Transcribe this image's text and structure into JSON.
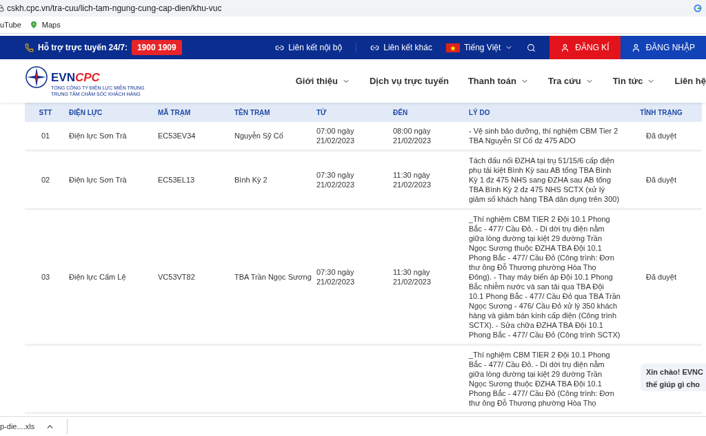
{
  "browser": {
    "url": "cskh.cpc.vn/tra-cuu/lich-tam-ngung-cung-cap-dien/khu-vuc",
    "bookmarks": [
      {
        "label": "uTube",
        "kind": "video"
      },
      {
        "label": "Maps",
        "kind": "maps"
      }
    ]
  },
  "topbar": {
    "support_label": "Hỗ trợ trực tuyến 24/7:",
    "hotline": "1900 1909",
    "links": [
      "Liên kết nội bộ",
      "Liên kết khác"
    ],
    "language": "Tiếng Việt",
    "register": "ĐĂNG KÍ",
    "login": "ĐĂNG NHẬP"
  },
  "header": {
    "logo": {
      "brand_a": "EVN",
      "brand_b": "CPC",
      "line1": "TỔNG CÔNG TY ĐIỆN LỰC MIỀN TRUNG",
      "line2": "TRUNG TÂM CHĂM SÓC KHÁCH HÀNG"
    },
    "nav": [
      {
        "label": "Giới thiệu",
        "dropdown": true
      },
      {
        "label": "Dịch vụ trực tuyến",
        "dropdown": false
      },
      {
        "label": "Thanh toán",
        "dropdown": true
      },
      {
        "label": "Tra cứu",
        "dropdown": true
      },
      {
        "label": "Tin tức",
        "dropdown": true
      },
      {
        "label": "Liên hệ",
        "dropdown": false
      }
    ]
  },
  "table": {
    "columns": [
      "STT",
      "ĐIỆN LỰC",
      "MÃ TRẠM",
      "TÊN TRẠM",
      "TỪ",
      "ĐẾN",
      "LÝ DO",
      "TÌNH TRẠNG"
    ],
    "rows": [
      {
        "stt": "01",
        "dien_luc": "Điện lực Sơn Trà",
        "ma_tram": "EC53EV34",
        "ten_tram": "Nguyễn Sỹ Cố",
        "tu": "07:00 ngày 21/02/2023",
        "den": "08:00 ngày 21/02/2023",
        "ly_do": "- Vệ sinh bảo dưỡng, thí nghiệm CBM Tier 2 TBA Nguyễn Sĩ Cố đz 475 ADO",
        "tinh_trang": "Đã duyệt"
      },
      {
        "stt": "02",
        "dien_luc": "Điện lực Sơn Trà",
        "ma_tram": "EC53EL13",
        "ten_tram": "Bình Kỳ 2",
        "tu": "07:30 ngày 21/02/2023",
        "den": "11:30 ngày 21/02/2023",
        "ly_do": "Tách đấu nối ĐZHA tại trụ 51/15/6 cấp điện phụ tải kiệt Bình Kỳ sau AB tổng TBA Bình Kỳ 1 đz 475 NHS sang ĐZHA sau AB tổng TBA Bình Kỳ 2 đz 475 NHS SCTX (xử lý giảm số khách hàng TBA dân dụng trên 300)",
        "tinh_trang": "Đã duyệt"
      },
      {
        "stt": "03",
        "dien_luc": "Điện lực Cẩm Lệ",
        "ma_tram": "VC53VT82",
        "ten_tram": "TBA Trần Ngọc Sương",
        "tu": "07:30 ngày 21/02/2023",
        "den": "11:30 ngày 21/02/2023",
        "ly_do": "_Thí nghiệm CBM TIER 2 Đội 10.1 Phong Bắc - 477/ Cầu Đỏ. - Di dời trụ điện nằm giữa lòng đường tại kiệt 29 đường Trần Ngọc Sương thuộc ĐZHA TBA Đội 10.1 Phong Bắc - 477/ Cầu Đỏ (Công trình: Đơn thư ông Đỗ Thương phường Hòa Thọ Đông). - Thay máy biến áp Đội 10.1 Phong Bắc nhiễm nước và san tải qua TBA Đội 10.1 Phong Bắc - 477/ Cầu Đỏ qua TBA Trần Ngọc Sương - 476/ Cầu Đỏ xử lý 350 khách hàng và giảm bán kính cấp điện (Công trình SCTX). - Sửa chữa ĐZHA TBA Đội 10.1 Phong Bắc - 477/ Cầu Đỏ (Công trình SCTX)",
        "tinh_trang": "Đã duyệt"
      },
      {
        "ly_do": "_Thí nghiệm CBM TIER 2 Đội 10.1 Phong Bắc - 477/ Cầu Đỏ. - Di dời trụ điện nằm giữa lòng đường tại kiệt 29 đường Trần Ngọc Sương thuộc ĐZHA TBA Đội 10.1 Phong Bắc - 477/ Cầu Đỏ (Công trình: Đơn thư ông Đỗ Thương phường Hòa Thọ"
      }
    ]
  },
  "chat": {
    "lines": [
      "Xin chào! EVNC",
      "thế giúp gì cho"
    ]
  },
  "download": {
    "file": "p-die....xls"
  }
}
